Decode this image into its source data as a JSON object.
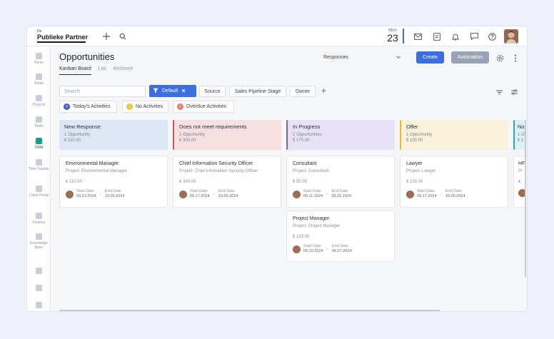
{
  "brand": {
    "small": "De",
    "name": "Publieke Partner"
  },
  "date": {
    "day": "Mon",
    "num": "23"
  },
  "sidebar": [
    {
      "label": "Home",
      "icon": "home-icon"
    },
    {
      "label": "Email",
      "icon": "email-icon"
    },
    {
      "label": "Projects",
      "icon": "projects-icon"
    },
    {
      "label": "Tasks",
      "icon": "tasks-icon"
    },
    {
      "label": "CRM",
      "icon": "crm-icon"
    },
    {
      "label": "Time Tracker",
      "icon": "time-tracker-icon"
    },
    {
      "label": "Client Portal",
      "icon": "client-portal-icon"
    },
    {
      "label": "Finance",
      "icon": "finance-icon"
    },
    {
      "label": "Knowledge Base",
      "icon": "knowledge-base-icon"
    }
  ],
  "page": {
    "title": "Opportunities",
    "tabs": [
      "Kanban Board",
      "List",
      "Archived"
    ],
    "responses": "Responses",
    "create": "Create",
    "automation": "Automation"
  },
  "filters": {
    "search_placeholder": "Search",
    "default": "Default",
    "source": "Source",
    "pipeline": "Sales Pipeline Stage",
    "owner": "Owner"
  },
  "activities": [
    {
      "count": "0",
      "label": "Today's Activities",
      "color": "#3b5ccc"
    },
    {
      "count": "1",
      "label": "No Activities",
      "color": "#e8c43c"
    },
    {
      "count": "0",
      "label": "Overdue Activities",
      "color": "#e07a6b"
    }
  ],
  "columns": [
    {
      "title": "New Response",
      "count": "1 Opportunity",
      "amount": "€ 110.00",
      "bg": "#dde6f6",
      "accent": ""
    },
    {
      "title": "Does not meet requirements",
      "count": "1 Opportunity",
      "amount": "€ 300.00",
      "bg": "#f8dfe2",
      "accent": "#d9534f"
    },
    {
      "title": "In Progress",
      "count": "2 Opportunities",
      "amount": "$ 170.00",
      "bg": "#e7e2f6",
      "accent": "#7b5fd3"
    },
    {
      "title": "Offer",
      "count": "1 Opportunity",
      "amount": "$ 100.00",
      "bg": "#faf1d9",
      "accent": "#e8b93a"
    },
    {
      "title": "No",
      "count": "1 O",
      "amount": "€ 1",
      "bg": "#dff0f4",
      "accent": "#2aa9c4"
    }
  ],
  "cards": [
    {
      "title": "Environmental Manager",
      "project": "Project: Environmental Manager",
      "price": "€ 110.00",
      "start_label": "Start Date",
      "start": "09.23.2024",
      "end_label": "End Date",
      "end": "10.06.2024"
    },
    {
      "title": "Chief Information Security Officer",
      "project": "Project: Chief Information Security Officer",
      "price": "€ 300.00",
      "start_label": "Start Date",
      "start": "09.17.2024",
      "end_label": "End Date",
      "end": "10.05.2024"
    },
    {
      "title": "Consultant",
      "project": "Project: Consultant",
      "price": "$ 50.00",
      "start_label": "Start Date",
      "start": "09.11.2024",
      "end_label": "End Date",
      "end": "09.22.2024"
    },
    {
      "title": "Lawyer",
      "project": "Project: Lawyer",
      "price": "$ 100.00",
      "start_label": "Start Date",
      "start": "09.17.2024",
      "end_label": "End Date",
      "end": "10.06.2024"
    },
    {
      "title": "HF",
      "project": "Pr",
      "price": "€",
      "start_label": "",
      "start": "",
      "end_label": "",
      "end": ""
    },
    {
      "title": "Project Manager",
      "project": "Project: Project Manager",
      "price": "$ 120.00",
      "start_label": "Start Date",
      "start": "09.10.2024",
      "end_label": "End Date",
      "end": "09.27.2024"
    }
  ]
}
